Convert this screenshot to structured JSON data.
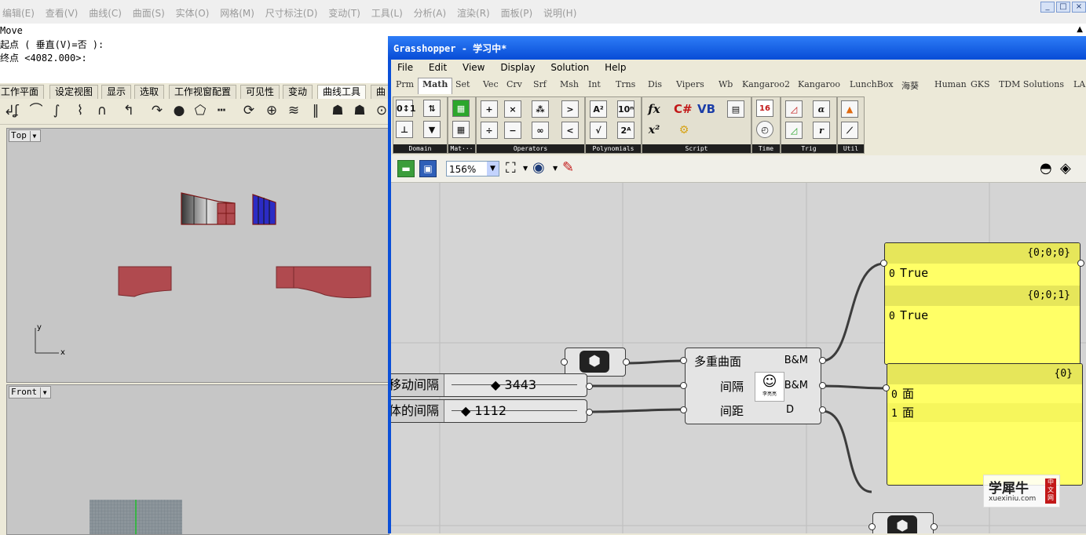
{
  "rhino": {
    "menu": [
      "编辑(E)",
      "查看(V)",
      "曲线(C)",
      "曲面(S)",
      "实体(O)",
      "网格(M)",
      "尺寸标注(D)",
      "变动(T)",
      "工具(L)",
      "分析(A)",
      "渲染(R)",
      "面板(P)",
      "说明(H)"
    ],
    "command_lines": [
      "Move",
      "起点 ( 垂直(V)=否 ):",
      "终点 <4082.000>:"
    ],
    "toolbar_tabs": [
      "工作平面",
      "设定视图",
      "显示",
      "选取",
      "工作视窗配置",
      "可见性",
      "变动",
      "曲线工具",
      "曲面"
    ],
    "active_toolbar_tab": "曲线工具",
    "viewport_top_label": "Top",
    "viewport_front_label": "Front",
    "axis_y": "y",
    "axis_x": "x"
  },
  "gh": {
    "title": "Grasshopper - 学习中*",
    "menu": [
      "File",
      "Edit",
      "View",
      "Display",
      "Solution",
      "Help"
    ],
    "tabs": [
      "Prm",
      "Math",
      "Set",
      "Vec",
      "Crv",
      "Srf",
      "Msh",
      "Int",
      "Trns",
      "Dis",
      "Vipers",
      "Wb",
      "Kangaroo2",
      "Kangaroo",
      "LunchBox",
      "海葵",
      "Human",
      "GKS",
      "TDM Solutions",
      "LA"
    ],
    "active_tab": "Math",
    "panels": [
      "Domain",
      "Mat···",
      "Operators",
      "Polynomials",
      "Script",
      "Time",
      "Trig",
      "Util"
    ],
    "zoom": "156%",
    "sliders": [
      {
        "label": "移动间隔",
        "value": "3443"
      },
      {
        "label": "体的间隔",
        "value": "1112"
      }
    ],
    "component": {
      "inputs": [
        "多重曲面",
        "间隔",
        "间距"
      ],
      "outputs": [
        "B&M",
        "B&M",
        "D"
      ],
      "icon_label": "李亮亮"
    },
    "panel1": {
      "rows": [
        {
          "path": "{0;0;0}",
          "index": "0",
          "value": "True"
        },
        {
          "path": "{0;0;1}",
          "index": "0",
          "value": "True"
        }
      ]
    },
    "panel2": {
      "path": "{0}",
      "rows": [
        {
          "index": "0",
          "value": "面"
        },
        {
          "index": "1",
          "value": "面"
        }
      ]
    }
  },
  "watermark": {
    "brand": "学犀牛",
    "url": "xuexiniu.com",
    "tag": "中文网"
  },
  "colors": {
    "gh_title": "#0a4fd8",
    "panel_yellow": "#ffff66",
    "surface_red": "#b04a4f",
    "surface_blue": "#2b2bc4"
  }
}
